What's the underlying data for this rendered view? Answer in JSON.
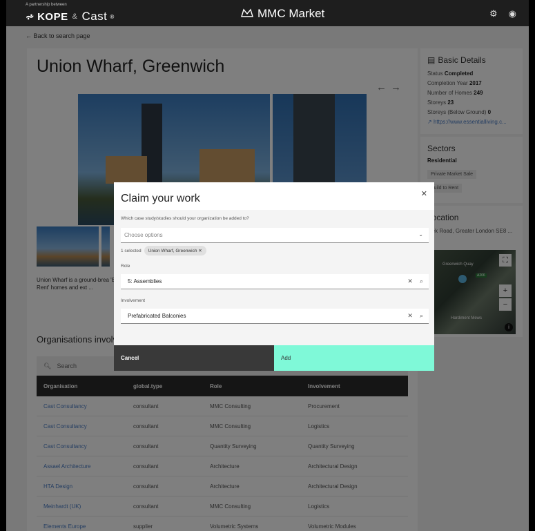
{
  "header": {
    "partnership": "A partnership between",
    "brand1": "KOPE",
    "amp": "&",
    "brand2": "Cast",
    "reg": "®",
    "title": "MMC Market",
    "icons": [
      "gear-icon",
      "user-icon"
    ]
  },
  "back_link": "← Back to search page",
  "project": {
    "title": "Union Wharf, Greenwich",
    "description": "Union Wharf is a ground-brea 'Build to Rent' homes and ext ..."
  },
  "basic_details": {
    "heading": "Basic Details",
    "status_label": "Status",
    "status": "Completed",
    "year_label": "Completion Year",
    "year": "2017",
    "homes_label": "Number of Homes",
    "homes": "249",
    "storeys_label": "Storeys",
    "storeys": "23",
    "below_label": "Storeys (Below Ground)",
    "below": "0",
    "link": "https://www.essentialliving.c..."
  },
  "sectors": {
    "heading": "Sectors",
    "main": "Residential",
    "chips": [
      "Private Market Sale",
      "Build to Rent"
    ]
  },
  "location": {
    "heading": "Location",
    "address": "...ek Road, Greater London SE8 ...",
    "map_label": "Greenwich Quay",
    "map_label2": "Hardiment Mews",
    "map_road": "A206"
  },
  "organisations": {
    "title": "Organisations involved",
    "search_placeholder": "Search",
    "columns": [
      "Organisation",
      "global.type",
      "Role",
      "Involvement"
    ],
    "rows": [
      [
        "Cast Consultancy",
        "consultant",
        "MMC Consulting",
        "Procurement"
      ],
      [
        "Cast Consultancy",
        "consultant",
        "MMC Consulting",
        "Logistics"
      ],
      [
        "Cast Consultancy",
        "consultant",
        "Quantity Surveying",
        "Quantity Surveying"
      ],
      [
        "Assael Architecture",
        "consultant",
        "Architecture",
        "Architectural Design"
      ],
      [
        "HTA Design",
        "consultant",
        "Architecture",
        "Architectural Design"
      ],
      [
        "Meinhardt (UK)",
        "consultant",
        "MMC Consulting",
        "Logistics"
      ],
      [
        "Elements Europe",
        "supplier",
        "Volumetric Systems",
        "Volumetric Modules"
      ]
    ]
  },
  "modal": {
    "title": "Claim your work",
    "question": "Which case study/studies should your organization be added to?",
    "choose_placeholder": "Choose options",
    "selected_count": "1 selected",
    "selected_tag": "Union Wharf, Greenwich",
    "role_label": "Role",
    "role_value": "5: Assemblies",
    "involvement_label": "Involvement",
    "involvement_value": "Prefabricated Balconies",
    "cancel": "Cancel",
    "add": "Add"
  }
}
